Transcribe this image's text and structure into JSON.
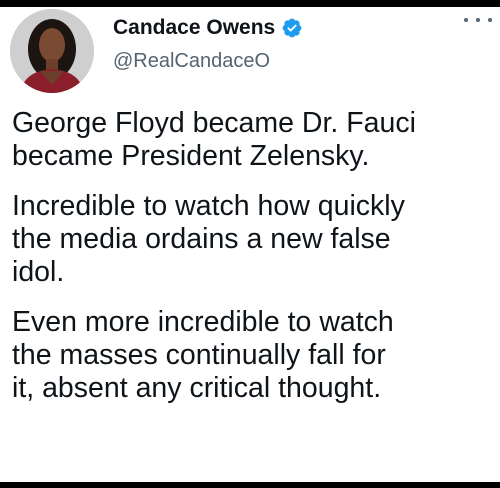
{
  "tweet": {
    "display_name": "Candace Owens",
    "handle": "@RealCandaceO",
    "verified": true,
    "paragraphs": [
      "George Floyd became Dr. Fauci\nbecame President Zelensky.",
      "Incredible to watch how quickly\nthe media ordains a new false\nidol.",
      "Even more incredible to watch\nthe masses continually fall for\nit, absent any critical thought."
    ]
  },
  "icons": {
    "verified": "verified-badge-icon",
    "more": "more-options-icon",
    "avatar": "profile-photo"
  },
  "colors": {
    "verified_blue": "#1d9bf0",
    "text_primary": "#0f1419",
    "text_secondary": "#536471"
  }
}
